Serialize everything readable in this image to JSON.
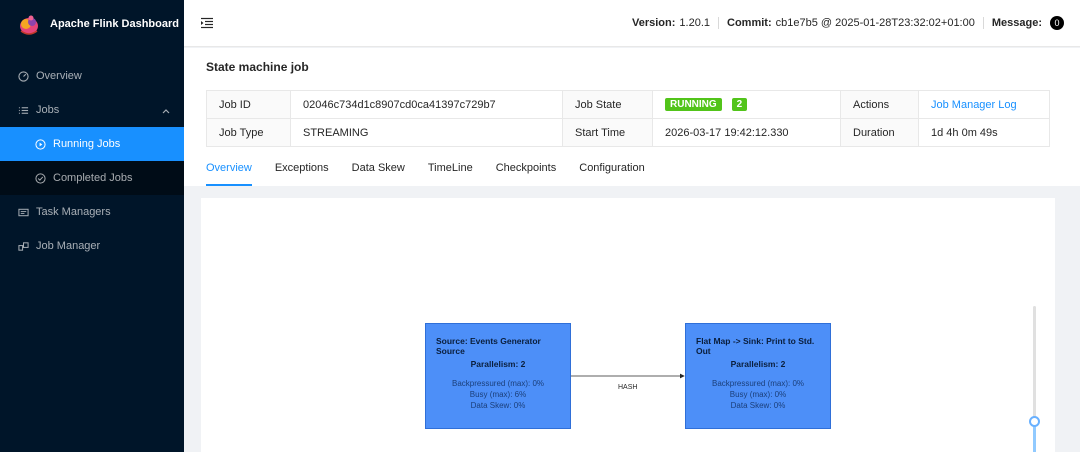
{
  "brand": {
    "title": "Apache Flink Dashboard"
  },
  "sidebar": {
    "items": [
      {
        "label": "Overview",
        "icon": "dashboard-icon"
      },
      {
        "label": "Jobs",
        "icon": "list-icon"
      },
      {
        "label": "Running Jobs",
        "icon": "play-circle-icon"
      },
      {
        "label": "Completed Jobs",
        "icon": "check-circle-icon"
      },
      {
        "label": "Task Managers",
        "icon": "task-managers-icon"
      },
      {
        "label": "Job Manager",
        "icon": "cluster-icon"
      }
    ]
  },
  "header": {
    "version_label": "Version:",
    "version_value": "1.20.1",
    "commit_label": "Commit:",
    "commit_value": "cb1e7b5 @ 2025-01-28T23:32:02+01:00",
    "message_label": "Message:",
    "message_count": "0"
  },
  "job": {
    "title": "State machine job",
    "id_label": "Job ID",
    "id_value": "02046c734d1c8907cd0ca41397c729b7",
    "state_label": "Job State",
    "state_value": "RUNNING",
    "state_count": "2",
    "actions_label": "Actions",
    "actions_link": "Job Manager Log",
    "type_label": "Job Type",
    "type_value": "STREAMING",
    "start_label": "Start Time",
    "start_value": "2026-03-17 19:42:12.330",
    "duration_label": "Duration",
    "duration_value": "1d 4h 0m 49s",
    "status_color": "#52c41a"
  },
  "tabs": [
    "Overview",
    "Exceptions",
    "Data Skew",
    "TimeLine",
    "Checkpoints",
    "Configuration"
  ],
  "graph": {
    "nodes": [
      {
        "title": "Source: Events Generator Source",
        "parallelism": "Parallelism: 2",
        "backpressured": "Backpressured (max): 0%",
        "busy": "Busy (max): 6%",
        "skew": "Data Skew: 0%"
      },
      {
        "title": "Flat Map -> Sink: Print to Std. Out",
        "parallelism": "Parallelism: 2",
        "backpressured": "Backpressured (max): 0%",
        "busy": "Busy (max): 0%",
        "skew": "Data Skew: 0%"
      }
    ],
    "edge_label": "HASH",
    "node_color": "#4d8ff8"
  },
  "accent": "#1890ff"
}
